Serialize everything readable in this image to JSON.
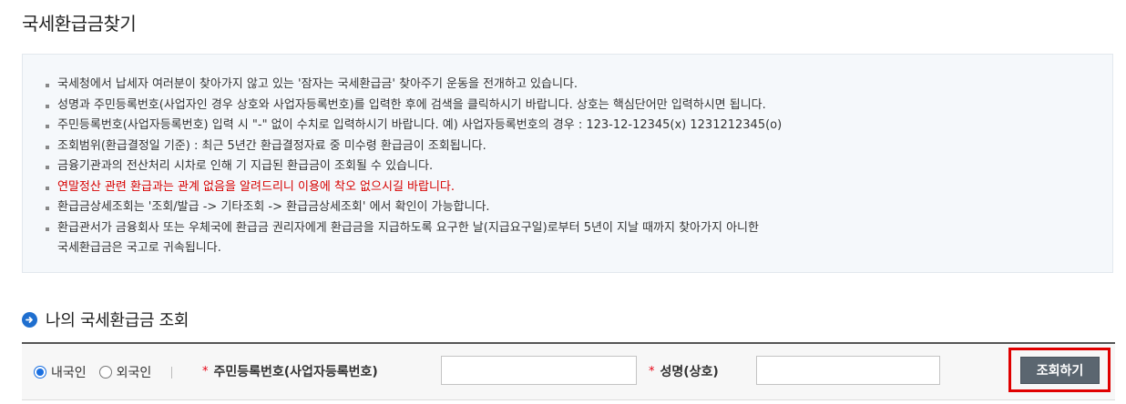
{
  "page": {
    "title": "국세환급금찾기"
  },
  "notice": {
    "items": [
      {
        "text": "국세청에서 납세자 여러분이 찾아가지 않고 있는 '잠자는 국세환급금' 찾아주기 운동을 전개하고 있습니다.",
        "warn": false
      },
      {
        "text": "성명과 주민등록번호(사업자인 경우 상호와 사업자등록번호)를 입력한 후에 검색을 클릭하시기 바랍니다. 상호는 핵심단어만 입력하시면 됩니다.",
        "warn": false
      },
      {
        "text": "주민등록번호(사업자등록번호) 입력 시 \"-\" 없이 수치로 입력하시기 바랍니다. 예) 사업자등록번호의 경우 : 123-12-12345(x) 1231212345(o)",
        "warn": false
      },
      {
        "text": "조회범위(환급결정일 기준) : 최근 5년간 환급결정자료 중 미수령 환급금이 조회됩니다.",
        "warn": false
      },
      {
        "text": "금융기관과의 전산처리 시차로 인해 기 지급된 환급금이 조회될 수 있습니다.",
        "warn": false
      },
      {
        "text": "연말정산 관련 환급과는 관계 없음을 알려드리니 이용에 착오 없으시길 바랍니다.",
        "warn": true
      },
      {
        "text": "환급금상세조회는 '조회/발급 -> 기타조회 -> 환급금상세조회' 에서 확인이 가능합니다.",
        "warn": false
      },
      {
        "text": "환급관서가 금융회사 또는 우체국에 환급금 권리자에게 환급금을 지급하도록 요구한 날(지급요구일)로부터 5년이 지날 때까지 찾아가지 아니한",
        "cont": "국세환급금은 국고로 귀속됩니다.",
        "warn": false
      }
    ]
  },
  "section": {
    "title": "나의 국세환급금 조회",
    "icon": "arrow-circle-icon"
  },
  "search": {
    "radio_domestic": "내국인",
    "radio_foreign": "외국인",
    "selected": "내국인",
    "required_mark": "*",
    "id_label": "주민등록번호(사업자등록번호)",
    "id_value": "",
    "name_label": "성명(상호)",
    "name_value": "",
    "button_label": "조회하기",
    "accent_color": "#1a6fe0",
    "warn_color": "#d60000"
  }
}
